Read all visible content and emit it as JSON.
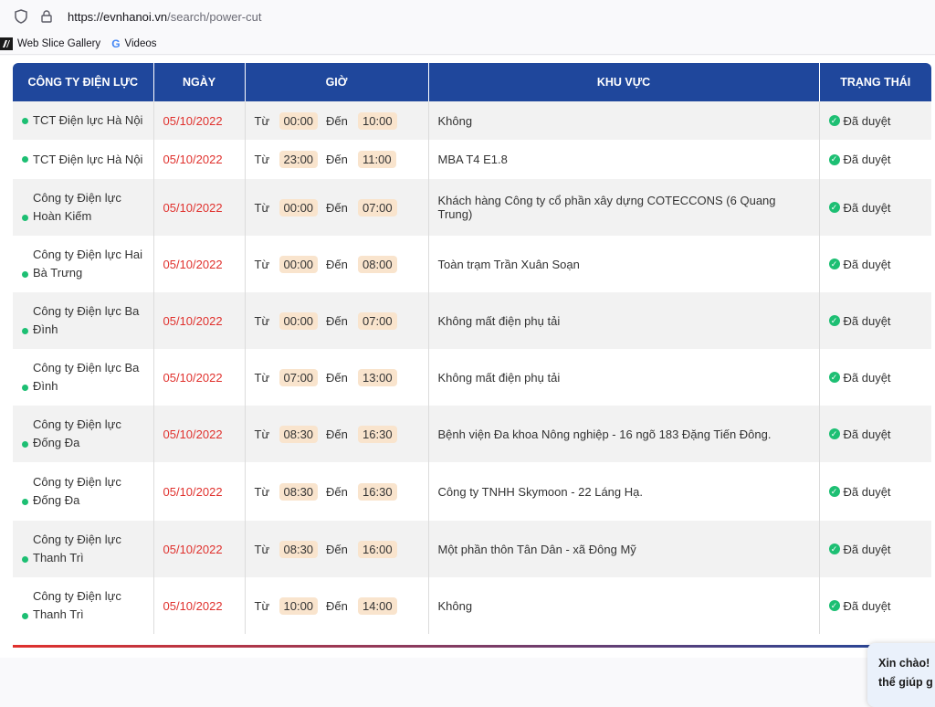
{
  "browser": {
    "url_host": "https://evnhanoi.vn",
    "url_path": "/search/power-cut",
    "bookmarks": [
      {
        "label": "Web Slice Gallery"
      },
      {
        "label": "Videos"
      }
    ]
  },
  "table": {
    "headers": [
      "CÔNG TY ĐIỆN LỰC",
      "NGÀY",
      "GIỜ",
      "KHU VỰC",
      "TRẠNG THÁI"
    ],
    "from_label": "Từ",
    "to_label": "Đến",
    "rows": [
      {
        "company": "TCT Điện lực Hà Nội",
        "date": "05/10/2022",
        "from": "00:00",
        "to": "10:00",
        "area": "Không",
        "status": "Đã duyệt"
      },
      {
        "company": "TCT Điện lực Hà Nội",
        "date": "05/10/2022",
        "from": "23:00",
        "to": "11:00",
        "area": "MBA T4 E1.8",
        "status": "Đã duyệt"
      },
      {
        "company": "Công ty Điện lực Hoàn Kiếm",
        "date": "05/10/2022",
        "from": "00:00",
        "to": "07:00",
        "area": "Khách hàng Công ty cổ phần xây dựng COTECCONS (6 Quang Trung)",
        "status": "Đã duyệt"
      },
      {
        "company": "Công ty Điện lực Hai Bà Trưng",
        "date": "05/10/2022",
        "from": "00:00",
        "to": "08:00",
        "area": "Toàn trạm Trần Xuân Soạn",
        "status": "Đã duyệt"
      },
      {
        "company": "Công ty Điện lực Ba Đình",
        "date": "05/10/2022",
        "from": "00:00",
        "to": "07:00",
        "area": "Không mất điện phụ tải",
        "status": "Đã duyệt"
      },
      {
        "company": "Công ty Điện lực Ba Đình",
        "date": "05/10/2022",
        "from": "07:00",
        "to": "13:00",
        "area": "Không mất điện phụ tải",
        "status": "Đã duyệt"
      },
      {
        "company": "Công ty Điện lực Đống Đa",
        "date": "05/10/2022",
        "from": "08:30",
        "to": "16:30",
        "area": "Bệnh viện Đa khoa Nông nghiệp - 16 ngõ 183 Đặng Tiến Đông.",
        "status": "Đã duyệt"
      },
      {
        "company": "Công ty Điện lực Đống Đa",
        "date": "05/10/2022",
        "from": "08:30",
        "to": "16:30",
        "area": "Công ty TNHH Skymoon - 22 Láng Hạ.",
        "status": "Đã duyệt"
      },
      {
        "company": "Công ty Điện lực Thanh Trì",
        "date": "05/10/2022",
        "from": "08:30",
        "to": "16:00",
        "area": "Một phần thôn Tân Dân - xã Đông Mỹ",
        "status": "Đã duyệt"
      },
      {
        "company": "Công ty Điện lực Thanh Trì",
        "date": "05/10/2022",
        "from": "10:00",
        "to": "14:00",
        "area": "Không",
        "status": "Đã duyệt"
      }
    ]
  },
  "chat": {
    "line1": "Xin chào!",
    "line2": "thể giúp g"
  }
}
